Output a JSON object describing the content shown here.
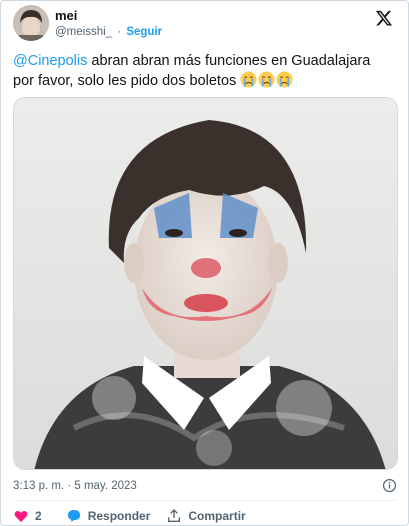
{
  "author": {
    "display_name": "mei",
    "handle": "@meisshi_",
    "separator": "·",
    "follow_label": "Seguir"
  },
  "tweet": {
    "mention": "@Cinepolis",
    "text": " abran abran más  funciones en Guadalajara por favor, solo les pido dos boletos ",
    "emojis": [
      "crying-face",
      "crying-face",
      "crying-face"
    ]
  },
  "meta": {
    "timestamp": "3:13 p. m. · 5 may. 2023"
  },
  "actions": {
    "like_count": "2",
    "reply_label": "Responder",
    "share_label": "Compartir"
  },
  "colors": {
    "accent": "#1d9bf0",
    "like": "#f91880",
    "text": "#0f1419",
    "secondary": "#536471"
  }
}
